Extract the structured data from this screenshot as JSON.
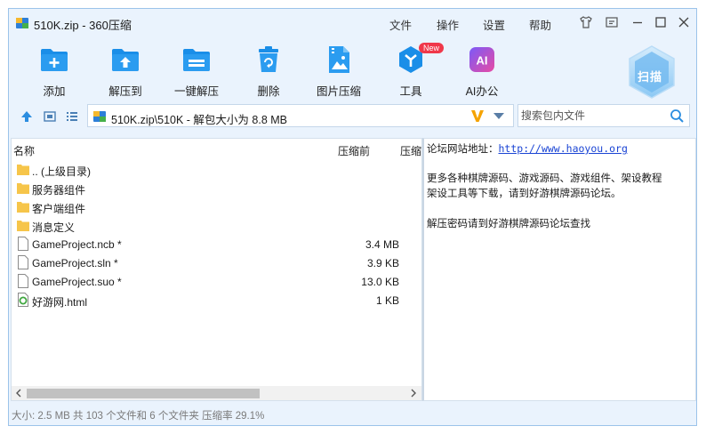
{
  "window": {
    "title": "510K.zip - 360压缩",
    "menus": [
      "文件",
      "操作",
      "设置",
      "帮助"
    ]
  },
  "toolbar": {
    "items": [
      {
        "label": "添加",
        "icon": "add-folder-icon"
      },
      {
        "label": "解压到",
        "icon": "extract-to-icon"
      },
      {
        "label": "一键解压",
        "icon": "one-click-extract-icon"
      },
      {
        "label": "删除",
        "icon": "recycle-bin-icon"
      },
      {
        "label": "图片压缩",
        "icon": "image-compress-icon"
      },
      {
        "label": "工具",
        "icon": "tools-icon",
        "badge": "New"
      },
      {
        "label": "AI办公",
        "icon": "ai-office-icon",
        "icon_text": "AI"
      }
    ],
    "scan_label": "扫描"
  },
  "address": {
    "path": "510K.zip\\510K - 解包大小为 8.8 MB",
    "search_placeholder": "搜索包内文件"
  },
  "file_list": {
    "columns": [
      "名称",
      "压缩前",
      "压缩"
    ],
    "rows": [
      {
        "name": ".. (上级目录)",
        "size": "",
        "type": "folder"
      },
      {
        "name": "服务器组件",
        "size": "",
        "type": "folder"
      },
      {
        "name": "客户端组件",
        "size": "",
        "type": "folder"
      },
      {
        "name": "消息定义",
        "size": "",
        "type": "folder"
      },
      {
        "name": "GameProject.ncb *",
        "size": "3.4 MB",
        "type": "file"
      },
      {
        "name": "GameProject.sln *",
        "size": "3.9 KB",
        "type": "file"
      },
      {
        "name": "GameProject.suo *",
        "size": "13.0 KB",
        "type": "file"
      },
      {
        "name": "好游网.html",
        "size": "1 KB",
        "type": "html"
      }
    ]
  },
  "comment": {
    "site_label": "论坛网站地址：",
    "site_url": "http://www.haoyou.org",
    "line2": "更多各种棋牌源码、游戏源码、游戏组件、架设教程",
    "line3": "架设工具等下载，请到好游棋牌源码论坛。",
    "line4": "解压密码请到好游棋牌源码论坛查找"
  },
  "status": "大小: 2.5 MB 共 103 个文件和 6 个文件夹 压缩率 29.1%",
  "colors": {
    "accent": "#1a8ee8",
    "window_bg": "#eaf3fd",
    "folder": "#f6c54a",
    "new_badge": "#f0384a",
    "v_logo": "#f5a300"
  }
}
